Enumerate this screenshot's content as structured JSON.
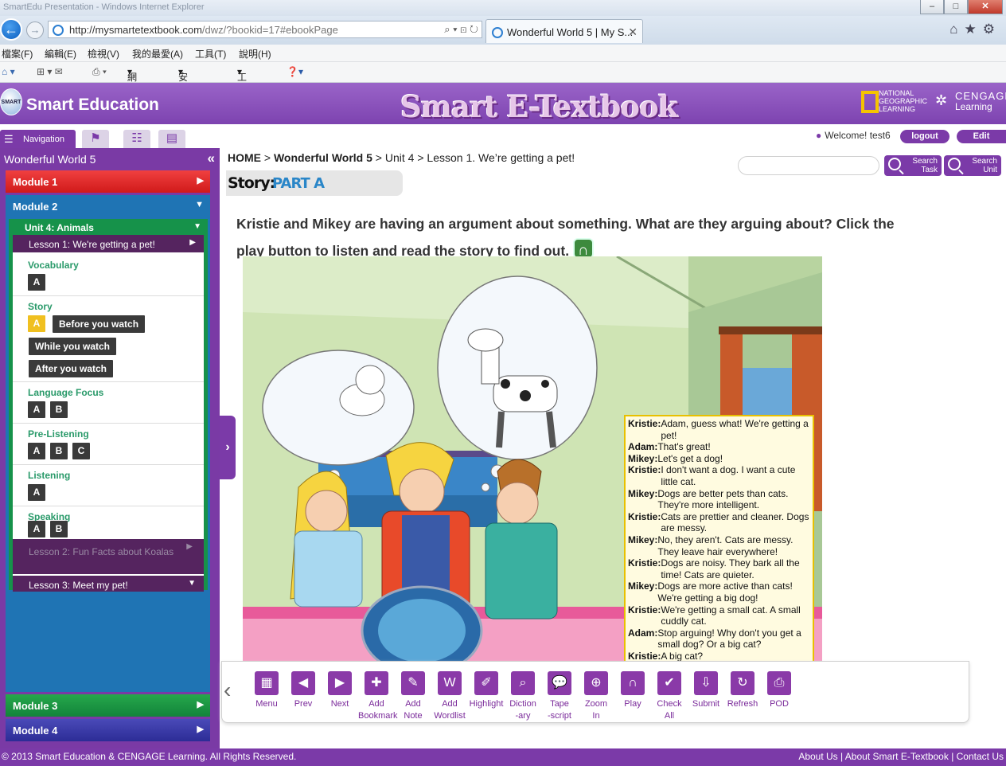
{
  "browser": {
    "window_title": "SmartEdu Presentation - Windows Internet Explorer",
    "url_host": "http://mysmartetextbook.com",
    "url_path": "/dwz/?bookid=17#ebookPage",
    "tab_title": "Wonderful World 5 | My S...",
    "menu": [
      "檔案(F)",
      "編輯(E)",
      "檢視(V)",
      "我的最愛(A)",
      "工具(T)",
      "說明(H)"
    ],
    "commands": [
      "網頁(P)",
      "安全性(S)",
      "工具(O)"
    ]
  },
  "header": {
    "brand": "Smart Education",
    "etextbook": "Smart E-Textbook",
    "partner1": "NATIONAL GEOGRAPHIC LEARNING",
    "partner2": "CENGAGE",
    "partner2_sub": "Learning"
  },
  "topbar": {
    "nav_tab": "Navigation",
    "welcome": "Welcome! test6",
    "logout": "logout",
    "edit": "Edit"
  },
  "sidebar": {
    "book": "Wonderful World 5",
    "module1": "Module 1",
    "module2": "Module 2",
    "module3": "Module 3",
    "module4": "Module 4",
    "unit": "Unit 4: Animals",
    "lesson1": "Lesson 1: We're getting a pet!",
    "lesson2": "Lesson 2: Fun Facts about Koalas",
    "lesson3": "Lesson 3: Meet my pet!",
    "sections": {
      "vocabulary": "Vocabulary",
      "story": "Story",
      "language_focus": "Language Focus",
      "pre_listening": "Pre-Listening",
      "listening": "Listening",
      "speaking": "Speaking"
    },
    "before_watch": "Before you watch",
    "while_watch": "While you watch",
    "after_watch": "After you watch",
    "btn_a": "A",
    "btn_b": "B",
    "btn_c": "C"
  },
  "breadcrumb": {
    "home": "HOME",
    "book": "Wonderful World 5",
    "unit": "Unit 4",
    "lesson": "Lesson 1. We’re getting a pet!"
  },
  "search": {
    "task_1": "Search",
    "task_2": "Task",
    "unit_1": "Search",
    "unit_2": "Unit"
  },
  "story_label": "Story:",
  "part_label": "PART A",
  "instructions": "Kristie and Mikey are having an argument about something. What are they arguing about? Click the play button to listen and read the story to find out.",
  "script": [
    {
      "speaker": "Kristie:",
      "text": "Adam, guess what! We're getting a pet!"
    },
    {
      "speaker": "Adam:",
      "text": "That's great!"
    },
    {
      "speaker": "Mikey:",
      "text": "Let's get a dog!"
    },
    {
      "speaker": "Kristie:",
      "text": "I don't want a dog.  I want a cute little cat."
    },
    {
      "speaker": "Mikey:",
      "text": "Dogs are better pets than cats. They're more intelligent."
    },
    {
      "speaker": "Kristie:",
      "text": "Cats are prettier and cleaner. Dogs are messy."
    },
    {
      "speaker": "Mikey:",
      "text": "No, they aren't. Cats are messy.  They leave hair everywhere!"
    },
    {
      "speaker": "Kristie:",
      "text": "Dogs are noisy. They bark all the time! Cats are quieter."
    },
    {
      "speaker": "Mikey:",
      "text": "Dogs are more active than cats! We're getting a big dog!"
    },
    {
      "speaker": "Kristie:",
      "text": "We're getting a small cat. A small cuddly cat."
    },
    {
      "speaker": "Adam:",
      "text": "Stop arguing! Why don't you get a small dog? Or a big cat?"
    },
    {
      "speaker": "Kristie:",
      "text": "A big cat?"
    }
  ],
  "toolbar": [
    {
      "label": "Menu",
      "icon": "menu-icon"
    },
    {
      "label": "Prev",
      "icon": "prev-icon"
    },
    {
      "label": "Next",
      "icon": "next-icon"
    },
    {
      "label": "Add Bookmark",
      "icon": "bookmark-icon"
    },
    {
      "label": "Add Note",
      "icon": "note-icon"
    },
    {
      "label": "Add Wordlist",
      "icon": "wordlist-icon"
    },
    {
      "label": "Highlight",
      "icon": "highlight-icon"
    },
    {
      "label": "Diction -ary",
      "icon": "dictionary-icon"
    },
    {
      "label": "Tape -script",
      "icon": "tapescript-icon"
    },
    {
      "label": "Zoom In",
      "icon": "zoom-in-icon"
    },
    {
      "label": "Play",
      "icon": "headphones-icon"
    },
    {
      "label": "Check All",
      "icon": "check-icon"
    },
    {
      "label": "Submit",
      "icon": "submit-icon"
    },
    {
      "label": "Refresh",
      "icon": "refresh-icon"
    },
    {
      "label": "POD",
      "icon": "print-icon"
    }
  ],
  "footer": {
    "copyright": "© 2013 Smart Education & CENGAGE Learning. All Rights Reserved.",
    "links": "About Us | About Smart E-Textbook | Contact Us"
  },
  "colors": {
    "brand_purple": "#7b3aa8",
    "module1": "#e02828",
    "module2": "#1f74b4",
    "module3": "#1a9642",
    "module4": "#3a3aa8"
  }
}
